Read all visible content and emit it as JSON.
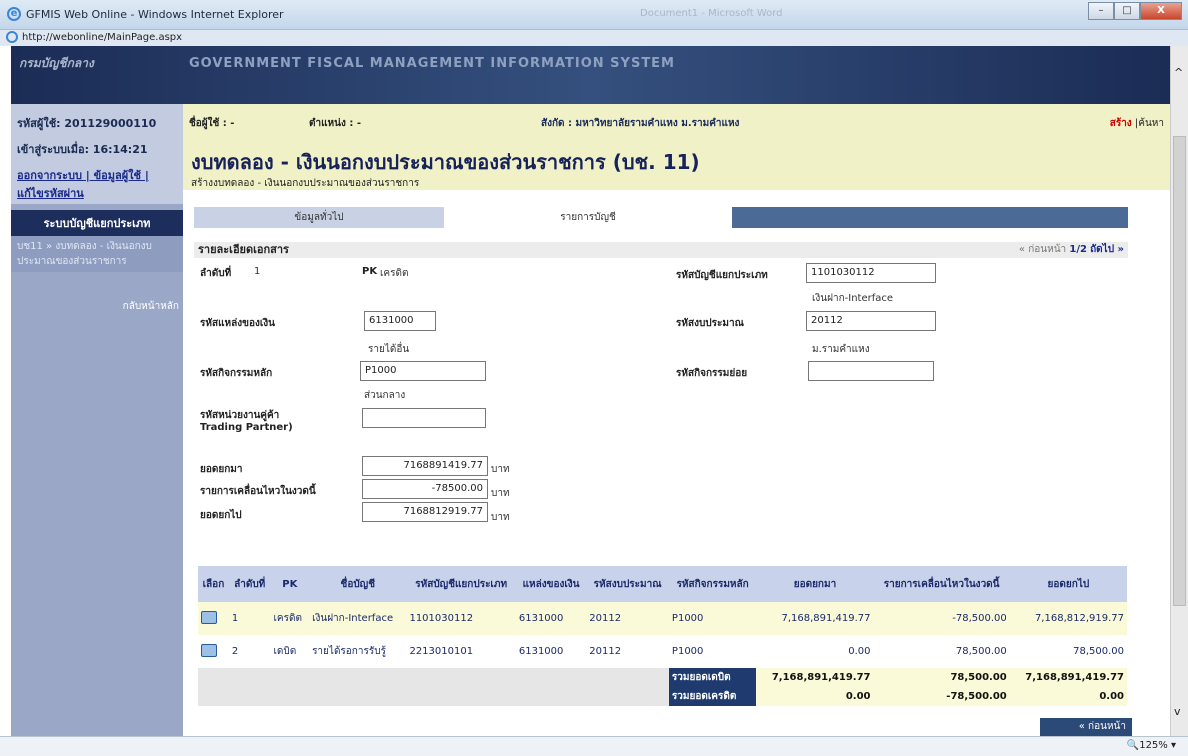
{
  "window": {
    "title": "GFMIS Web Online - Windows Internet Explorer",
    "ghost_title": "Document1 - Microsoft Word",
    "min": "–",
    "max": "□",
    "close": "X",
    "url": "http://webonline/MainPage.aspx",
    "zoom": "🔍125%  ▾"
  },
  "banner": {
    "system": "GOVERNMENT FISCAL MANAGEMENT INFORMATION SYSTEM",
    "logo": "กรมบัญชีกลาง"
  },
  "sidebar": {
    "user_code": "รหัสผู้ใช้: 201129000110",
    "login_time": "เข้าสู่ระบบเมื่อ:  16:14:21",
    "links": "ออกจากระบบ | ข้อมูลผู้ใช้ | แก้ไขรหัสผ่าน",
    "menu_title": "ระบบบัญชีแยกประเภท",
    "crumb": "บช11 » งบทดลอง - เงินนอกงบประมาณของส่วนราชการ",
    "back": "กลับหน้าหลัก"
  },
  "header": {
    "user_label": "ชื่อผู้ใช้ :  -",
    "position_label": "ตำแหน่ง :      -",
    "affiliation": "สังกัด  : มหาวิทยาลัยรามคำแหง ม.รามคำแหง",
    "create": "สร้าง",
    "search": "|ค้นหา",
    "title": "งบทดลอง - เงินนอกงบประมาณของส่วนราชการ (บช. 11)",
    "subtitle": "สร้างงบทดลอง - เงินนอกงบประมาณของส่วนราชการ"
  },
  "tabs": [
    "ข้อมูลทั่วไป",
    "รายการบัญชี"
  ],
  "details": {
    "section": "รายละเอียดเอกสาร",
    "pager": "« ก่อนหน้า",
    "page": "1/2",
    "next": "ถัดไป »",
    "seq_label": "ลำดับที่",
    "seq": "1",
    "pk_label": "PK",
    "pk": "เครดิต",
    "gl_label": "รหัสบัญชีแยกประเภท",
    "gl": "1101030112",
    "gl_desc": "เงินฝาก-Interface",
    "fund_label": "รหัสแหล่งของเงิน",
    "fund": "6131000",
    "fund_desc": "รายได้อื่น",
    "budget_label": "รหัสงบประมาณ",
    "budget": "20112",
    "budget_desc": "ม.รามคำแหง",
    "act_label": "รหัสกิจกรรมหลัก",
    "act": "P1000",
    "act_desc": "ส่วนกลาง",
    "subact_label": "รหัสกิจกรรมย่อย",
    "subact": "",
    "tp_label1": "รหัสหน่วยงานคู่ค้า",
    "tp_label2": "Trading Partner)",
    "tp": "",
    "bf_label": "ยอดยกมา",
    "bf": "7168891419.77",
    "mv_label": "รายการเคลื่อนไหวในงวดนี้",
    "mv": "-78500.00",
    "cf_label": "ยอดยกไป",
    "cf": "7168812919.77",
    "unit": "บาท"
  },
  "grid": {
    "headers": [
      "เลือก",
      "ลำดับที่",
      "PK",
      "ชื่อบัญชี",
      "รหัสบัญชีแยกประเภท",
      "แหล่งของเงิน",
      "รหัสงบประมาณ",
      "รหัสกิจกรรมหลัก",
      "ยอดยกมา",
      "รายการเคลื่อนไหวในงวดนี้",
      "ยอดยกไป"
    ],
    "rows": [
      {
        "seq": "1",
        "pk": "เครดิต",
        "name": "เงินฝาก-Interface",
        "gl": "1101030112",
        "fund": "6131000",
        "budget": "20112",
        "act": "P1000",
        "bf": "7,168,891,419.77",
        "mv": "-78,500.00",
        "cf": "7,168,812,919.77"
      },
      {
        "seq": "2",
        "pk": "เดบิต",
        "name": "รายได้รอการรับรู้",
        "gl": "2213010101",
        "fund": "6131000",
        "budget": "20112",
        "act": "P1000",
        "bf": "0.00",
        "mv": "78,500.00",
        "cf": "78,500.00"
      }
    ],
    "tot_debit_label": "รวมยอดเดบิต",
    "tot_debit": [
      "7,168,891,419.77",
      "78,500.00",
      "7,168,891,419.77"
    ],
    "tot_credit_label": "รวมยอดเครดิต",
    "tot_credit": [
      "0.00",
      "-78,500.00",
      "0.00"
    ]
  },
  "footer": {
    "prev": "« ก่อนหน้า"
  }
}
